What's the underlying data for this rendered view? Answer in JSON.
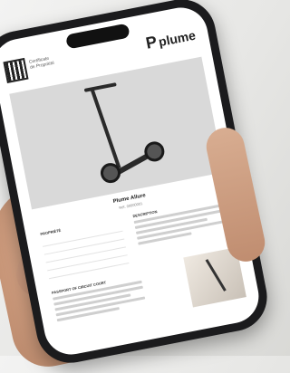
{
  "screen": {
    "certificate_label": "Certificate",
    "certificate_sub": "de Propriété",
    "brand": "plume",
    "brand_mark": "P",
    "product_title": "Plume Allure",
    "product_sub": "Réf. 00000001",
    "properties_heading": "PROPRIÉTÉ",
    "description_heading": "DESCRIPTION",
    "passport_heading": "PASSPORT OF CIRCUIT COURT"
  }
}
